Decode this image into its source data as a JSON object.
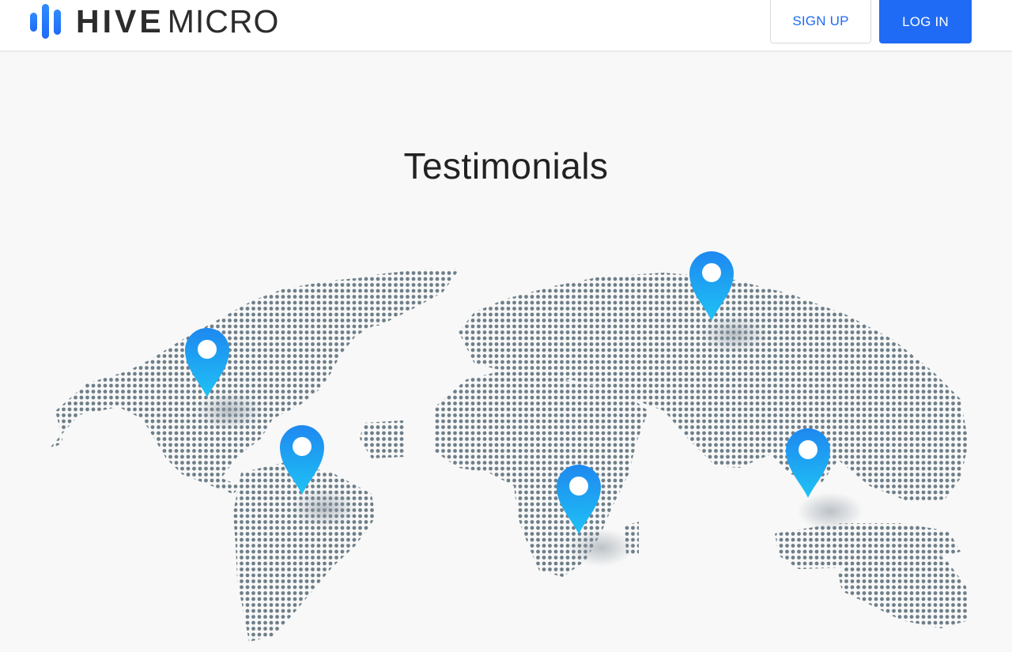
{
  "header": {
    "logo": {
      "word_bold": "HIVE",
      "word_light": "MICRO"
    },
    "signup_label": "SIGN UP",
    "login_label": "LOG IN"
  },
  "main": {
    "section_title": "Testimonials"
  },
  "colors": {
    "brand_blue": "#1f6bf5",
    "map_dot": "#6f7f89",
    "pin_top": "#1e88f0",
    "pin_bottom": "#1fc2f5",
    "page_background": "#f8f8f8"
  },
  "icons": {
    "logo_mark": "three-vertical-bars-icon",
    "map_pin": "location-pin-icon"
  }
}
